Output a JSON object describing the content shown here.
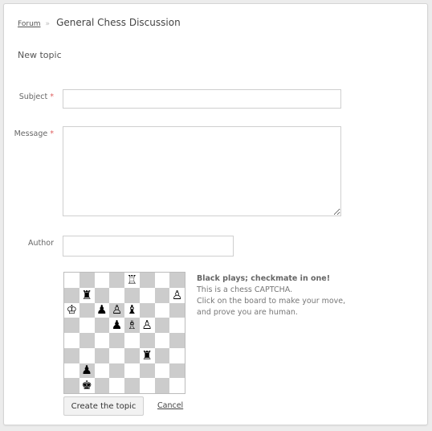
{
  "breadcrumb": {
    "root": "Forum",
    "separator": "»",
    "current": "General Chess Discussion"
  },
  "form": {
    "heading": "New topic",
    "subject": {
      "label": "Subject",
      "required_mark": "*",
      "value": ""
    },
    "message": {
      "label": "Message",
      "required_mark": "*",
      "value": ""
    },
    "author": {
      "label": "Author",
      "value": ""
    },
    "submit_label": "Create the topic",
    "cancel_label": "Cancel"
  },
  "captcha": {
    "title": "Black plays; checkmate in one!",
    "line1": "This is a chess CAPTCHA.",
    "line2": "Click on the board to make your move,",
    "line3": "and prove you are human.",
    "board": [
      [
        "",
        "",
        "",
        "",
        "♖",
        "",
        "",
        ""
      ],
      [
        "",
        "♜",
        "",
        "",
        "",
        "",
        "",
        "♙"
      ],
      [
        "♔",
        "",
        "♟",
        "♙",
        "♝",
        "",
        "",
        ""
      ],
      [
        "",
        "",
        "",
        "♟",
        "♗",
        "♙",
        "",
        ""
      ],
      [
        "",
        "",
        "",
        "",
        "",
        "",
        "",
        ""
      ],
      [
        "",
        "",
        "",
        "",
        "",
        "♜",
        "",
        ""
      ],
      [
        "",
        "♟",
        "",
        "",
        "",
        "",
        "",
        ""
      ],
      [
        "",
        "♚",
        "",
        "",
        "",
        "",
        "",
        ""
      ]
    ]
  }
}
